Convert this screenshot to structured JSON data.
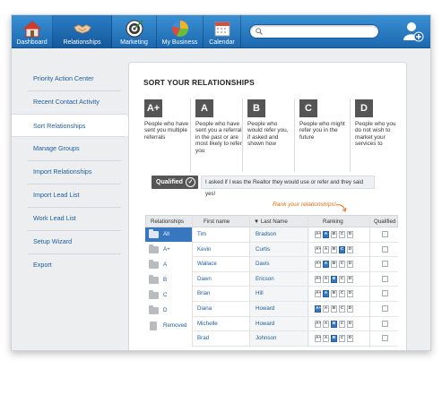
{
  "nav": [
    {
      "label": "Dashboard",
      "icon": "house-icon"
    },
    {
      "label": "Relationships",
      "icon": "handshake-icon"
    },
    {
      "label": "Marketing",
      "icon": "target-icon"
    },
    {
      "label": "My Business",
      "icon": "pie-chart-icon"
    },
    {
      "label": "Calendar",
      "icon": "calendar-icon"
    }
  ],
  "search": {
    "placeholder": ""
  },
  "sidebar": {
    "items": [
      {
        "label": "Priority Action Center"
      },
      {
        "label": "Recent Contact Activity"
      },
      {
        "label": "Sort Relationships"
      },
      {
        "label": "Manage Groups"
      },
      {
        "label": "Import Relationships"
      },
      {
        "label": "Import Lead List"
      },
      {
        "label": "Work Lead List"
      },
      {
        "label": "Setup Wizard"
      },
      {
        "label": "Export"
      }
    ],
    "active_index": 2
  },
  "main": {
    "title": "SORT YOUR RELATIONSHIPS",
    "grades": [
      {
        "letter": "A+",
        "desc": "People who have sent you multiple referrals"
      },
      {
        "letter": "A",
        "desc": "People who have sent you a referral in the past or are most likely to refer you"
      },
      {
        "letter": "B",
        "desc": "People who would refer you, if asked and shown how"
      },
      {
        "letter": "C",
        "desc": "People who might refer you in the future"
      },
      {
        "letter": "D",
        "desc": "People who you do not wish to market your services to"
      }
    ],
    "qualified_label": "Qualified",
    "qualified_text": "I asked if I was the Realtor they would use or refer and they said yes!",
    "rank_note": "Rank your relationships!"
  },
  "table": {
    "headers": {
      "relationships": "Relationships",
      "first": "First name",
      "last": "Last Name",
      "ranking": "Ranking",
      "qualified": "Qualified"
    },
    "sort_indicator": "▼",
    "ranking_letters": [
      "A+",
      "A",
      "B",
      "C",
      "D"
    ],
    "groups": [
      "All",
      "A+",
      "A",
      "B",
      "C",
      "D",
      "Removed"
    ],
    "selected_group_index": 0,
    "rows": [
      {
        "first": "Tim",
        "last": "Bradson",
        "rank": "A"
      },
      {
        "first": "Kevin",
        "last": "Curtis",
        "rank": "C"
      },
      {
        "first": "Wallace",
        "last": "Davis",
        "rank": "A"
      },
      {
        "first": "Dawn",
        "last": "Ericson",
        "rank": "B"
      },
      {
        "first": "Brian",
        "last": "Hill",
        "rank": "A"
      },
      {
        "first": "Diana",
        "last": "Howard",
        "rank": "A+"
      },
      {
        "first": "Michelle",
        "last": "Howard",
        "rank": "B"
      },
      {
        "first": "Brad",
        "last": "Johnson",
        "rank": "B"
      }
    ]
  },
  "colors": {
    "accent": "#1c68b0",
    "link": "#1d5d9f",
    "highlight": "#3777bf",
    "note": "#e2711d"
  }
}
